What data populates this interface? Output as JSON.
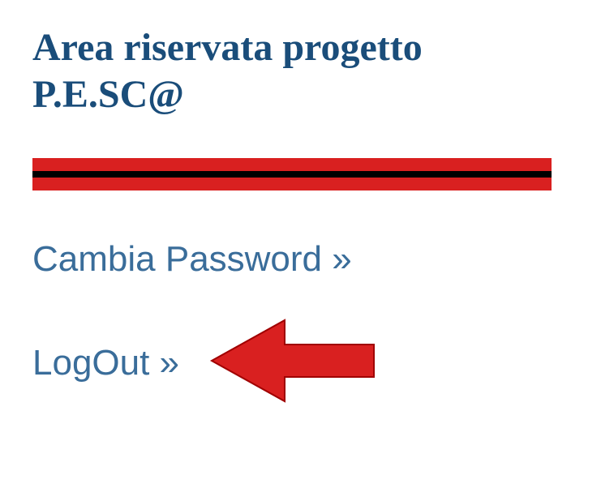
{
  "title": "Area riservata progetto P.E.SC@",
  "username_redacted": true,
  "links": {
    "change_password": "Cambia Password »",
    "logout": "LogOut »"
  },
  "annotations": {
    "arrow_color": "#d92020",
    "arrow_target": "logout-link"
  }
}
